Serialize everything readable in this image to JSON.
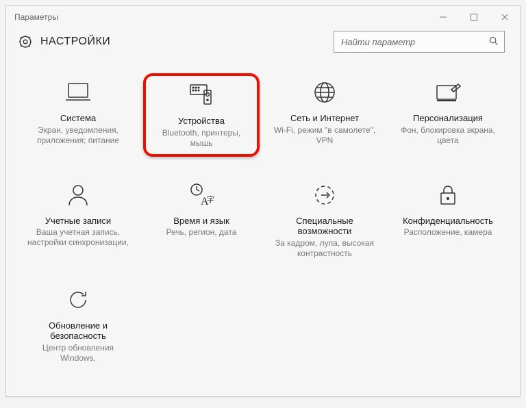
{
  "window": {
    "title": "Параметры"
  },
  "header": {
    "title": "НАСТРОЙКИ"
  },
  "search": {
    "placeholder": "Найти параметр"
  },
  "tiles": [
    {
      "id": "system",
      "title": "Система",
      "desc": "Экран, уведомления, приложения; питание"
    },
    {
      "id": "devices",
      "title": "Устройства",
      "desc": "Bluetooth, принтеры, мышь",
      "highlight": true
    },
    {
      "id": "network",
      "title": "Сеть и Интернет",
      "desc": "Wi-Fi, режим \"в самолете\", VPN"
    },
    {
      "id": "personalize",
      "title": "Персонализация",
      "desc": "Фон, блокировка экрана, цвета"
    },
    {
      "id": "accounts",
      "title": "Учетные записи",
      "desc": "Ваша учетная запись, настройки синхронизации,"
    },
    {
      "id": "timelang",
      "title": "Время и язык",
      "desc": "Речь, регион, дата"
    },
    {
      "id": "easeofaccess",
      "title": "Специальные возможности",
      "desc": "За кадром, лупа, высокая контрастность"
    },
    {
      "id": "privacy",
      "title": "Конфиденциальность",
      "desc": "Расположение, камера"
    },
    {
      "id": "update",
      "title": "Обновление и безопасность",
      "desc": "Центр обновления Windows,"
    }
  ],
  "colors": {
    "highlight": "#e91102"
  }
}
